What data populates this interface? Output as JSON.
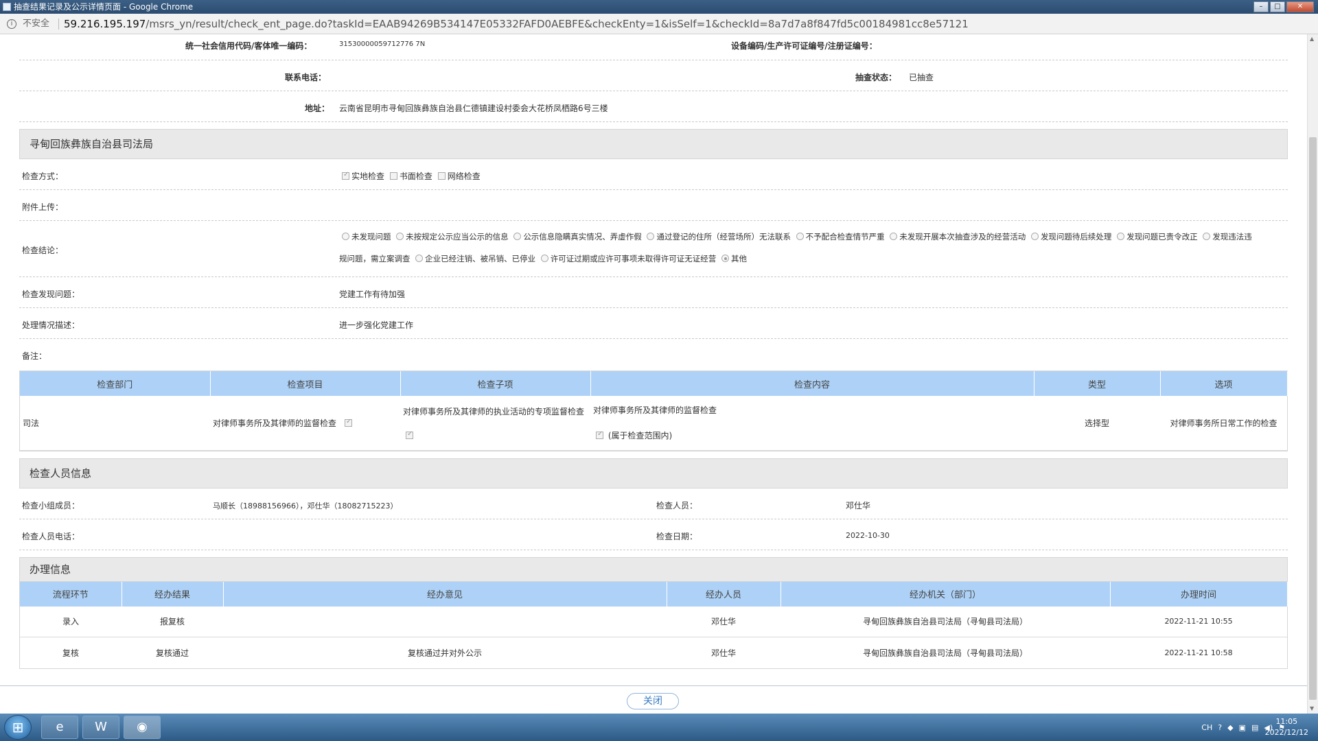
{
  "browser": {
    "window_title": "抽查结果记录及公示详情页面 - Google Chrome",
    "insecure_label": "不安全",
    "url_host": "59.216.195.197",
    "url_path": "/msrs_yn/result/check_ent_page.do?taskId=EAAB94269B534147E05332FAFD0AEBFE&checkEnty=1&isSelf=1&checkId=8a7d7a8f847fd5c00184981cc8e57121"
  },
  "info": {
    "credit_code_label": "统一社会信用代码/客体唯一编码：",
    "credit_code_value": "31530000059712776 7N",
    "device_label": "设备编码/生产许可证编号/注册证编号：",
    "device_value": "",
    "phone_label": "联系电话：",
    "phone_value": "",
    "status_label": "抽查状态：",
    "status_value": "已抽查",
    "address_label": "地址：",
    "address_value": "云南省昆明市寻甸回族彝族自治县仁德镇建设村委会大花桥凤栖路6号三楼"
  },
  "bureau": {
    "title": "寻甸回族彝族自治县司法局",
    "method_label": "检查方式：",
    "methods": [
      "实地检查",
      "书面检查",
      "网络检查"
    ],
    "attachment_label": "附件上传：",
    "conclusion_label": "检查结论：",
    "conclusions_line1": [
      "未发现问题",
      "未按规定公示应当公示的信息",
      "公示信息隐瞒真实情况、弄虚作假",
      "通过登记的住所（经营场所）无法联系",
      "不予配合检查情节严重",
      "未发现开展本次抽查涉及的经营活动",
      "发现问题待后续处理",
      "发现问题已责令改正",
      "发现违法违"
    ],
    "conclusions_line2_prefix": "规问题，需立案调查",
    "conclusions_line2": [
      "企业已经注销、被吊销、已停业",
      "许可证过期或应许可事项未取得许可证无证经营",
      "其他"
    ],
    "issue_label": "检查发现问题：",
    "issue_value": "党建工作有待加强",
    "handling_label": "处理情况描述：",
    "handling_value": "进一步强化党建工作",
    "remark_label": "备注：",
    "remark_value": ""
  },
  "check_table": {
    "headers": [
      "检查部门",
      "检查项目",
      "检查子项",
      "检查内容",
      "类型",
      "选项"
    ],
    "row": {
      "dept": "司法",
      "item": "对律师事务所及其律师的监督检查",
      "subitem": "对律师事务所及其律师的执业活动的专项监督检查",
      "content_line1": "对律师事务所及其律师的监督检查",
      "content_line2": "(属于检查范围内)",
      "type": "选择型",
      "option": "对律师事务所日常工作的检查"
    }
  },
  "inspectors": {
    "title": "检查人员信息",
    "group_label": "检查小组成员：",
    "group_value": "马顺长（18988156966），邓仕华（18082715223）",
    "inspector_label": "检查人员：",
    "inspector_value": "邓仕华",
    "phone_label": "检查人员电话：",
    "phone_value": "",
    "date_label": "检查日期：",
    "date_value": "2022-10-30"
  },
  "processing": {
    "title": "办理信息",
    "headers": [
      "流程环节",
      "经办结果",
      "经办意见",
      "经办人员",
      "经办机关（部门）",
      "办理时间"
    ],
    "rows": [
      {
        "step": "录入",
        "result": "报复核",
        "opinion": "",
        "person": "邓仕华",
        "org": "寻甸回族彝族自治县司法局（寻甸县司法局）",
        "time": "2022-11-21 10:55"
      },
      {
        "step": "复核",
        "result": "复核通过",
        "opinion": "复核通过并对外公示",
        "person": "邓仕华",
        "org": "寻甸回族彝族自治县司法局（寻甸县司法局）",
        "time": "2022-11-21 10:58"
      }
    ]
  },
  "close_button": "关闭",
  "taskbar": {
    "lang": "CH",
    "time": "11:05",
    "date": "2022/12/12"
  }
}
